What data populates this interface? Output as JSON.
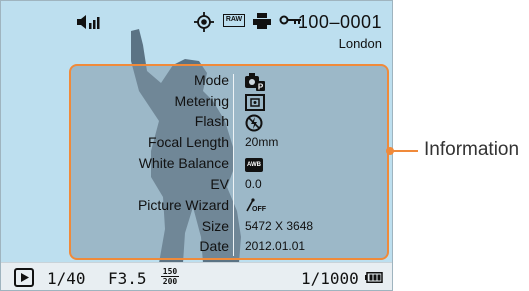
{
  "status_bar": {
    "file_number": "100–0001",
    "location": "London",
    "icons": [
      "battery-volume-icon",
      "af-point-icon",
      "raw-icon",
      "print-icon",
      "protect-key-icon"
    ],
    "raw_text": "RAW"
  },
  "info_panel": {
    "rows": [
      {
        "label": "Mode",
        "icon": "program-mode-icon"
      },
      {
        "label": "Metering",
        "icon": "metering-icon"
      },
      {
        "label": "Flash",
        "icon": "flash-off-icon"
      },
      {
        "label": "Focal Length",
        "value": "20mm"
      },
      {
        "label": "White Balance",
        "icon": "awb-icon",
        "icon_text": "AWB"
      },
      {
        "label": "EV",
        "value": "0.0"
      },
      {
        "label": "Picture Wizard",
        "icon": "picture-wizard-off-icon",
        "icon_text": "OFF"
      },
      {
        "label": "Size",
        "value": "5472 X 3648"
      },
      {
        "label": "Date",
        "value": "2012.01.01"
      }
    ]
  },
  "bottom_bar": {
    "play_icon": "play-icon",
    "shutter": "1/40",
    "aperture": "F3.5",
    "iso_top": "150",
    "iso_bottom": "200",
    "frames": "1/1000",
    "battery_icon": "battery-icon"
  },
  "callout": {
    "label": "Information"
  },
  "colors": {
    "screen_bg": "#bddfef",
    "accent": "#f08a3a",
    "panel": "#8298a8"
  }
}
